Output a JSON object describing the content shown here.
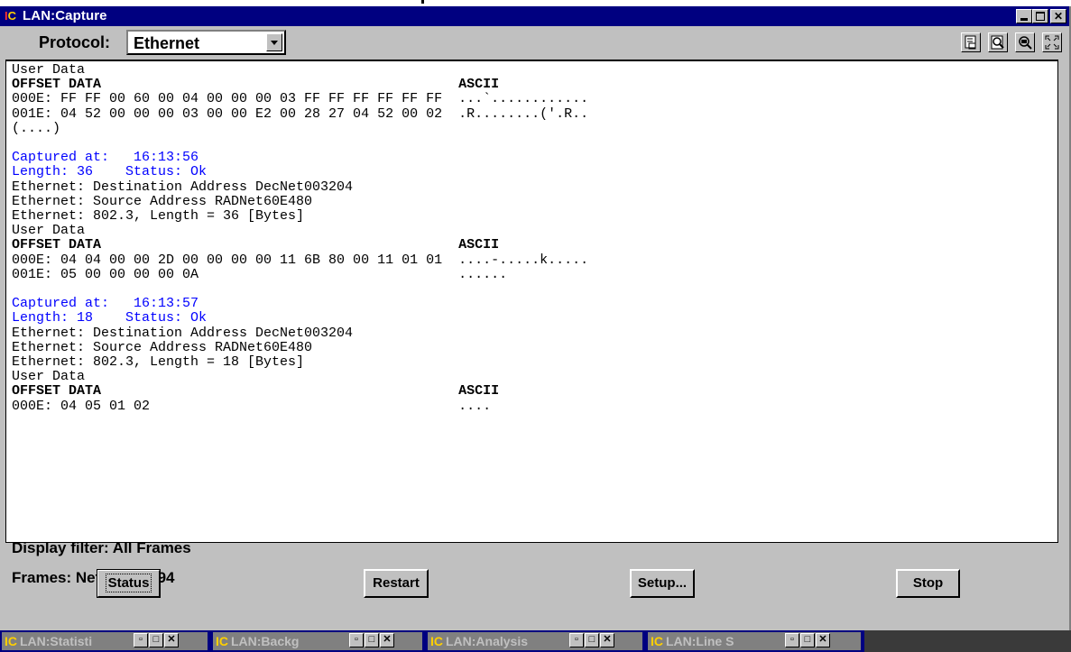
{
  "window": {
    "title": "LAN:Capture"
  },
  "toolbar": {
    "protocol_label": "Protocol:",
    "protocol_value": "Ethernet",
    "tools": [
      "print-preview-icon",
      "zoom-page-icon",
      "zoom-search-icon",
      "fullscreen-icon"
    ]
  },
  "capture_lines": [
    {
      "text": "User Data",
      "style": "normal"
    },
    {
      "text": "OFFSET DATA                                            ASCII",
      "style": "bold"
    },
    {
      "text": "000E: FF FF 00 60 00 04 00 00 00 03 FF FF FF FF FF FF  ...`............",
      "style": "normal"
    },
    {
      "text": "001E: 04 52 00 00 00 03 00 00 E2 00 28 27 04 52 00 02  .R........('.R..",
      "style": "normal"
    },
    {
      "text": "(....)",
      "style": "normal"
    },
    {
      "text": "",
      "style": "normal"
    },
    {
      "text": "Captured at:   16:13:56",
      "style": "blue"
    },
    {
      "text": "Length: 36    Status: Ok",
      "style": "blue"
    },
    {
      "text": "Ethernet: Destination Address DecNet003204",
      "style": "normal"
    },
    {
      "text": "Ethernet: Source Address RADNet60E480",
      "style": "normal"
    },
    {
      "text": "Ethernet: 802.3, Length = 36 [Bytes]",
      "style": "normal"
    },
    {
      "text": "User Data",
      "style": "normal"
    },
    {
      "text": "OFFSET DATA                                            ASCII",
      "style": "bold"
    },
    {
      "text": "000E: 04 04 00 00 2D 00 00 00 00 11 6B 80 00 11 01 01  ....-.....k.....",
      "style": "normal"
    },
    {
      "text": "001E: 05 00 00 00 00 0A                                ......",
      "style": "normal"
    },
    {
      "text": "",
      "style": "normal"
    },
    {
      "text": "Captured at:   16:13:57",
      "style": "blue"
    },
    {
      "text": "Length: 18    Status: Ok",
      "style": "blue"
    },
    {
      "text": "Ethernet: Destination Address DecNet003204",
      "style": "normal"
    },
    {
      "text": "Ethernet: Source Address RADNet60E480",
      "style": "normal"
    },
    {
      "text": "Ethernet: 802.3, Length = 18 [Bytes]",
      "style": "normal"
    },
    {
      "text": "User Data",
      "style": "normal"
    },
    {
      "text": "OFFSET DATA                                            ASCII",
      "style": "bold"
    },
    {
      "text": "000E: 04 05 01 02                                      ....",
      "style": "normal"
    }
  ],
  "footer": {
    "display_filter": "Display filter: All Frames",
    "frames": "Frames: Network 4094"
  },
  "buttons": {
    "status": "Status",
    "restart": "Restart",
    "setup": "Setup...",
    "stop": "Stop"
  },
  "taskbar": [
    {
      "label": "LAN:Statisti"
    },
    {
      "label": "LAN:Backg"
    },
    {
      "label": "LAN:Analysis"
    },
    {
      "label": "LAN:Line S"
    }
  ],
  "colors": {
    "titlebar": "#000080",
    "face": "#c0c0c0",
    "header_blue": "#0000ff"
  }
}
